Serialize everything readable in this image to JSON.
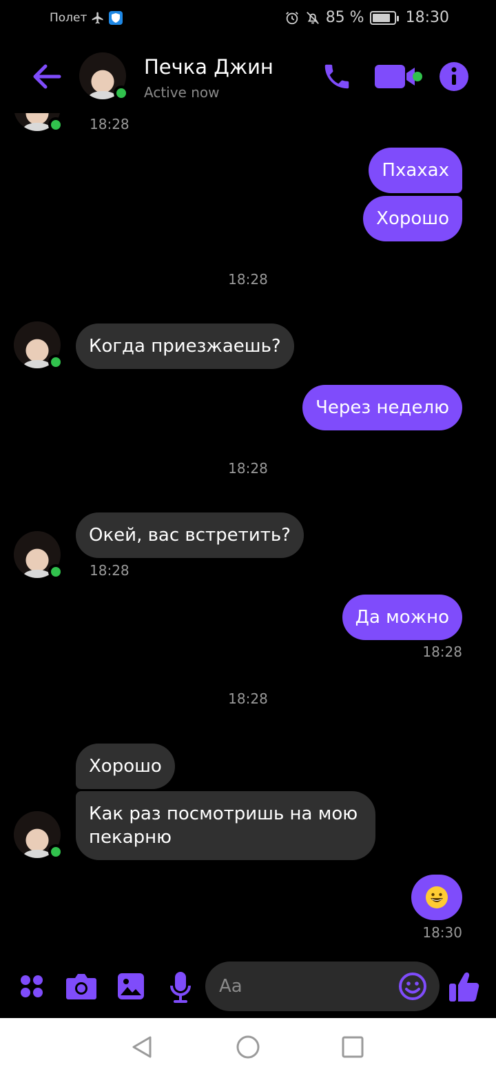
{
  "status_bar": {
    "mode_label": "Полет",
    "battery": "85 %",
    "battery_level": 0.85,
    "time": "18:30"
  },
  "header": {
    "name": "Печка Джин",
    "status": "Active now",
    "icons": [
      "back-arrow-icon",
      "phone-icon",
      "video-camera-icon",
      "info-icon"
    ]
  },
  "accent_color": "#7f4cfb",
  "online_color": "#31c24d",
  "messages": {
    "prev_time": "18:28",
    "m1": "Пхахах",
    "m2": "Хорошо",
    "divider1": "18:28",
    "m3": "Когда приезжаешь?",
    "m4": "Через неделю",
    "divider2": "18:28",
    "m5": "Окей, вас встретить?",
    "m5_time": "18:28",
    "m6": "Да можно",
    "m6_time": "18:28",
    "divider3": "18:28",
    "m7": "Хорошо",
    "m8_line1": "Как раз посмотришь на мою",
    "m8_line2": "пекарню",
    "m9_emoji": "😃",
    "m9_time": "18:30"
  },
  "composer": {
    "placeholder": "Aa",
    "icons": [
      "apps-icon",
      "camera-icon",
      "image-icon",
      "microphone-icon",
      "emoji-icon",
      "thumbs-up-icon"
    ]
  },
  "nav": {
    "icons": [
      "back-triangle-icon",
      "home-circle-icon",
      "recents-square-icon"
    ]
  }
}
